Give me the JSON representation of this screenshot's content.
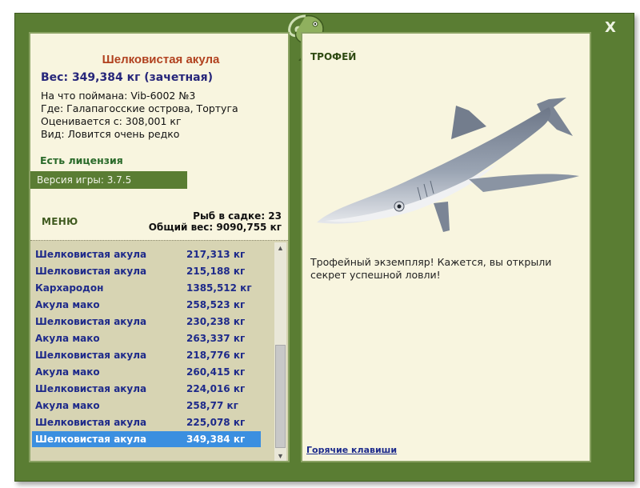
{
  "window": {
    "close_label": "X"
  },
  "fish": {
    "title": "Шелковистая акула",
    "weight_line": "Вес: 349,384 кг (зачетная)",
    "bait_line": "На что поймана: Vib-6002 №3",
    "location_line": "Где: Галапагосские острова, Тортуга",
    "value_line": "Оценивается с: 308,001 кг",
    "rarity_line": "Вид: Ловится очень редко"
  },
  "license": "Есть лицензия",
  "version": "Версия игры: 3.7.5",
  "menu": "МЕНЮ",
  "cage": {
    "count_line": "Рыб в садке: 23",
    "total_line": "Общий вес: 9090,755 кг"
  },
  "catch_list": {
    "selected_index": 12,
    "rows": [
      {
        "name": "Шелковистая акула",
        "weight": "217,313 кг"
      },
      {
        "name": "Шелковистая акула",
        "weight": "215,188 кг"
      },
      {
        "name": "Кархародон",
        "weight": "1385,512 кг"
      },
      {
        "name": "Акула мако",
        "weight": "258,523 кг"
      },
      {
        "name": "Шелковистая акула",
        "weight": "230,238 кг"
      },
      {
        "name": "Акула мако",
        "weight": "263,337 кг"
      },
      {
        "name": "Шелковистая акула",
        "weight": "218,776 кг"
      },
      {
        "name": "Акула мако",
        "weight": "260,415 кг"
      },
      {
        "name": "Шелковистая акула",
        "weight": "224,016 кг"
      },
      {
        "name": "Акула мако",
        "weight": "258,77 кг"
      },
      {
        "name": "Шелковистая акула",
        "weight": "225,078 кг"
      },
      {
        "name": "Шелковистая акула",
        "weight": "349,384 кг"
      }
    ]
  },
  "trophy": {
    "title": "ТРОФЕЙ",
    "text": "Трофейный экземпляр! Кажется, вы открыли секрет успешной ловли!",
    "image_icon": "shark-image"
  },
  "hotkeys": "Горячие клавиши",
  "colors": {
    "frame": "#5a7d33",
    "panel": "#f8f5df",
    "list_bg": "#d7d4b3",
    "selection": "#3b8fe0",
    "title_red": "#b1411f",
    "list_text": "#1e2a8a"
  }
}
